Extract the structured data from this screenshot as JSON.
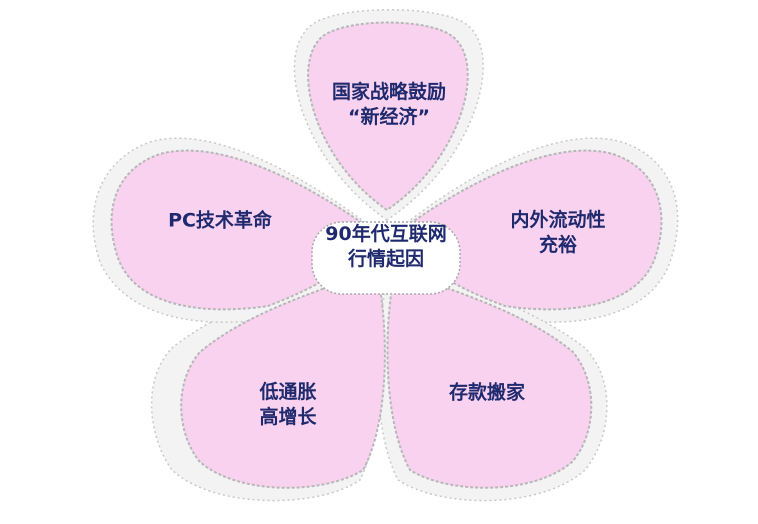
{
  "center": {
    "line1": "90年代互联网",
    "line2": "行情起因"
  },
  "petals": [
    {
      "id": "top",
      "line1": "国家战略鼓励",
      "line2": "“新经济”"
    },
    {
      "id": "right",
      "line1": "内外流动性",
      "line2": "充裕"
    },
    {
      "id": "bottom-right",
      "line1": "存款搬家",
      "line2": ""
    },
    {
      "id": "bottom-left",
      "line1": "低通胀",
      "line2": "高增长"
    },
    {
      "id": "left",
      "line1": "PC技术革命",
      "line2": ""
    }
  ],
  "colors": {
    "petal_fill": "#f9d2f0",
    "text": "#1f2a6e"
  }
}
